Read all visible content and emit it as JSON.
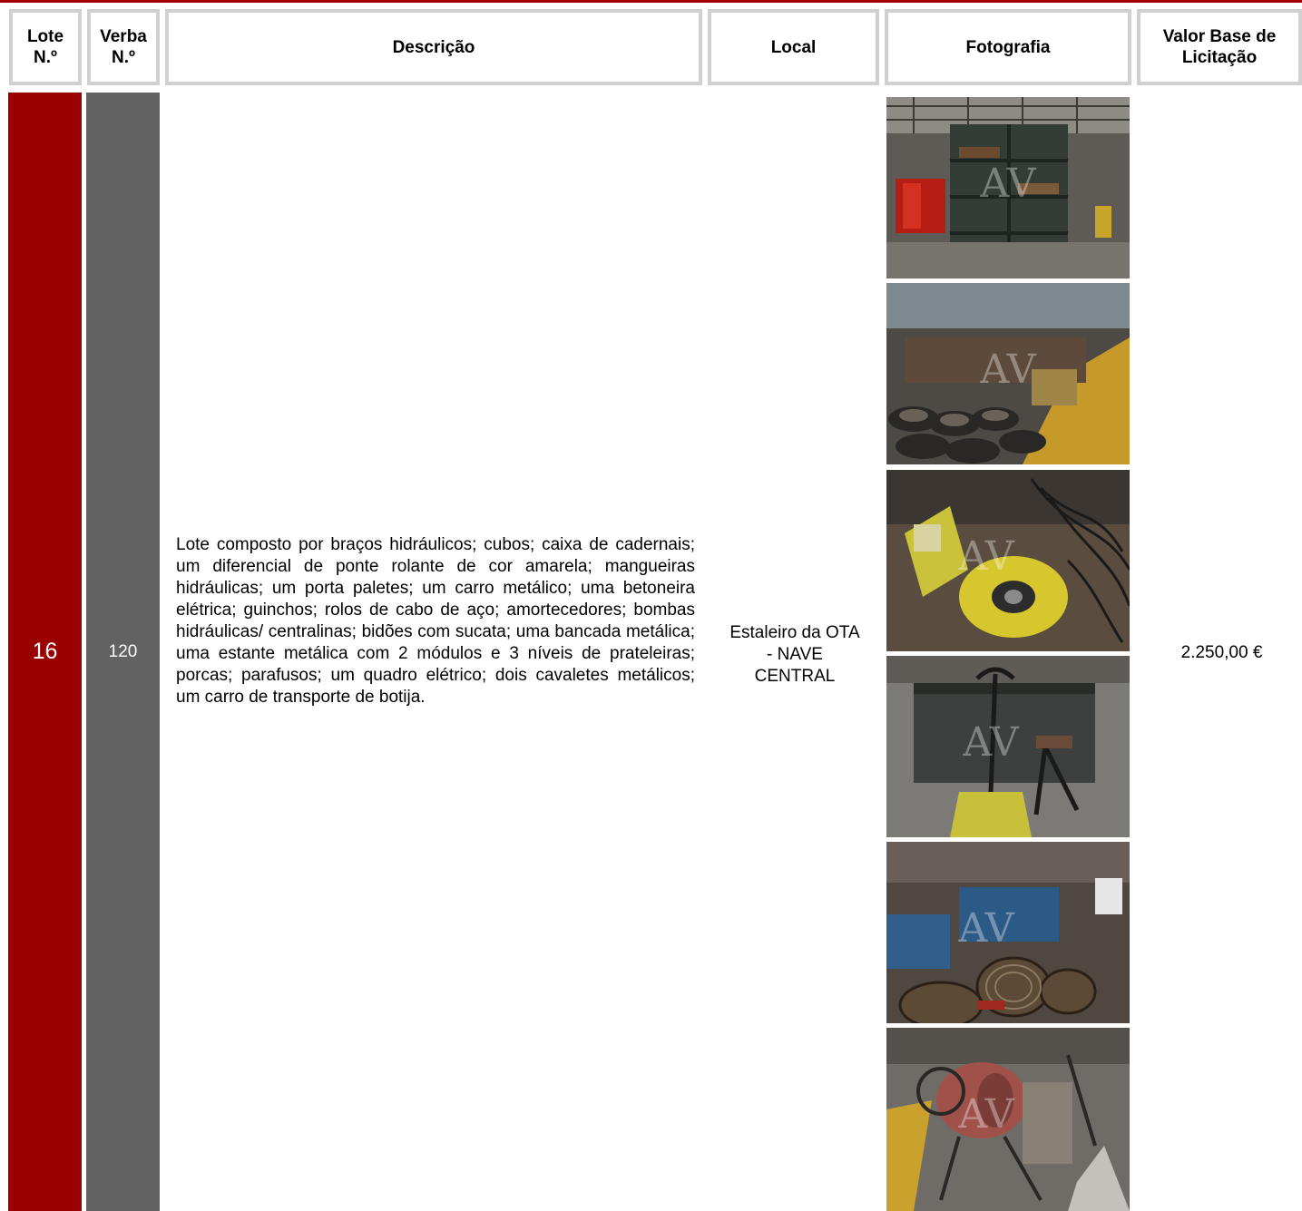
{
  "table": {
    "headers": {
      "lote": "Lote\nN.º",
      "verba": "Verba\nN.º",
      "descricao": "Descrição",
      "local": "Local",
      "fotografia": "Fotografia",
      "valor": "Valor Base de\nLicitação"
    },
    "row": {
      "lote": "16",
      "verba": "120",
      "descricao": "Lote composto por braços hidráulicos; cubos; caixa de cadernais; um diferencial de ponte rolante de cor amarela; mangueiras hidráulicas; um porta paletes; um carro metálico; uma betoneira elétrica; guinchos; rolos de cabo de aço; amortecedores; bombas hidráulicas/ centralinas; bidões com sucata; uma bancada metálica; uma estante metálica com 2 módulos e 3 níveis de prateleiras; porcas; parafusos; um quadro elétrico; dois cavaletes metálicos; um carro de transporte de botija.",
      "local": "Estaleiro da OTA\n- NAVE\nCENTRAL",
      "valor": "2.250,00 €"
    },
    "photos": [
      {
        "subject": "metal shelving with red drums",
        "watermark": "AV"
      },
      {
        "subject": "rows of hydraulic hubs and cable drums",
        "watermark": "AV"
      },
      {
        "subject": "yellow overhead crane hoist with hoses",
        "watermark": "AV"
      },
      {
        "subject": "pallet jack beside workbench",
        "watermark": "AV"
      },
      {
        "subject": "blue hydraulic pumps and wire rope reels",
        "watermark": "AV"
      },
      {
        "subject": "electric concrete mixer",
        "watermark": "AV"
      }
    ]
  },
  "colors": {
    "rule": "#a30000",
    "lote_fill": "#9b0000",
    "verba_fill": "#626262",
    "header_border": "#d0d0d0"
  }
}
